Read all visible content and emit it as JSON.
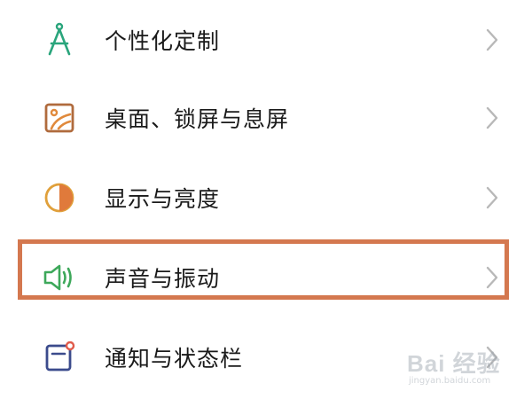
{
  "settings_list": {
    "items": [
      {
        "label": "个性化定制",
        "icon": "compass-icon",
        "color": "#2aa57c"
      },
      {
        "label": "桌面、锁屏与息屏",
        "icon": "wallpaper-icon",
        "color": "#b06b3d"
      },
      {
        "label": "显示与亮度",
        "icon": "brightness-icon",
        "color": "#e0893b"
      },
      {
        "label": "声音与振动",
        "icon": "speaker-icon",
        "color": "#3da85a"
      },
      {
        "label": "通知与状态栏",
        "icon": "notification-icon",
        "color": "#3b4b8c"
      }
    ],
    "highlighted_item": "声音与振动",
    "highlight_color": "#d4784f"
  },
  "watermark": {
    "brand": "Bai 经验",
    "url": "jingyan.baidu.com"
  }
}
